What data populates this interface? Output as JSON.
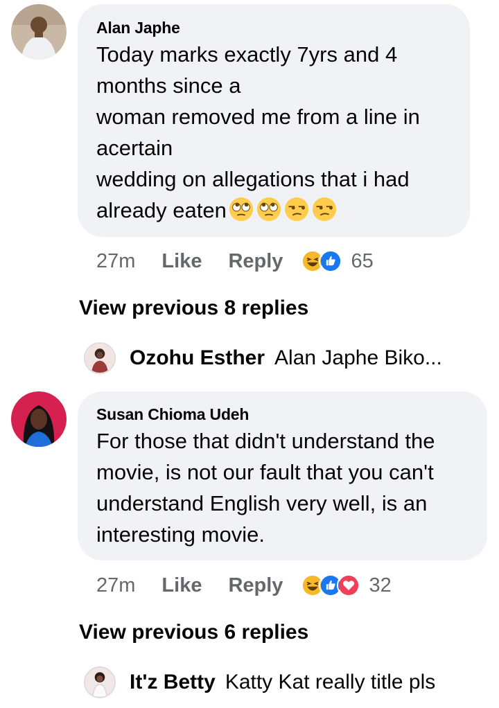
{
  "comments": [
    {
      "author": "Alan Japhe",
      "lines": [
        "Today marks exactly 7yrs and 4",
        "months since a",
        "woman removed me from a line in",
        "acertain",
        "wedding on allegations that i had",
        "already eaten"
      ],
      "emoji": [
        "face-with-rolling-eyes-emoji",
        "face-with-rolling-eyes-emoji",
        "unamused-face-emoji",
        "unamused-face-emoji"
      ],
      "time": "27m",
      "like_label": "Like",
      "reply_label": "Reply",
      "reactions": [
        "haha-reaction-icon",
        "like-reaction-icon"
      ],
      "reaction_count": "65",
      "view_previous": "View previous 8 replies",
      "latest_reply": {
        "author": "Ozohu Esther",
        "text": "Alan Japhe Biko..."
      }
    },
    {
      "author": "Susan Chioma Udeh",
      "lines": [
        "For those that didn't understand the",
        "movie, is not our fault that you can't",
        "understand English very well, is an",
        "interesting movie."
      ],
      "time": "27m",
      "like_label": "Like",
      "reply_label": "Reply",
      "reactions": [
        "haha-reaction-icon",
        "like-reaction-icon",
        "love-reaction-icon"
      ],
      "reaction_count": "32",
      "view_previous": "View previous 6 replies",
      "latest_reply": {
        "author": "It'z Betty",
        "text": "Katty Kat really title pls"
      }
    }
  ],
  "colors": {
    "bubble": "#f0f2f5",
    "secondary_text": "#65676b",
    "like_blue": "#1877f2",
    "love_red": "#f33e58",
    "haha_yellow": "#f7b928"
  }
}
